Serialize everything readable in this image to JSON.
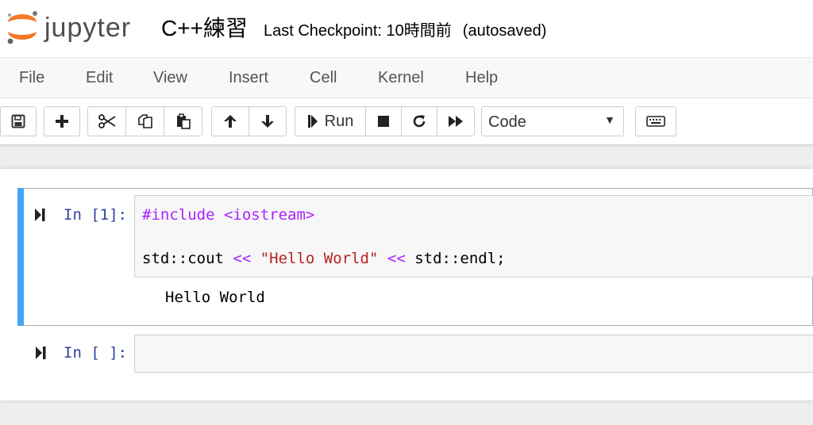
{
  "header": {
    "logo_text": "jupyter",
    "notebook_title": "C++練習",
    "checkpoint": "Last Checkpoint: 10時間前",
    "autosave_status": "(autosaved)"
  },
  "menu": [
    "File",
    "Edit",
    "View",
    "Insert",
    "Cell",
    "Kernel",
    "Help"
  ],
  "toolbar": {
    "run_label": "Run",
    "cell_type_selected": "Code"
  },
  "cells": [
    {
      "prompt": "In [1]:",
      "code_line1": {
        "meta": "#include <iostream>"
      },
      "code_line2": {
        "a": "std::cout ",
        "op1": "<<",
        "str": " \"Hello World\" ",
        "op2": "<<",
        "b": " std::endl;"
      },
      "output": "Hello World"
    },
    {
      "prompt": "In [ ]:"
    }
  ],
  "colors": {
    "selected_bar": "#42a5f5",
    "prompt": "#303f9f",
    "string": "#ba2121",
    "operator": "#aa22ff",
    "logo_orange": "#f37726"
  }
}
